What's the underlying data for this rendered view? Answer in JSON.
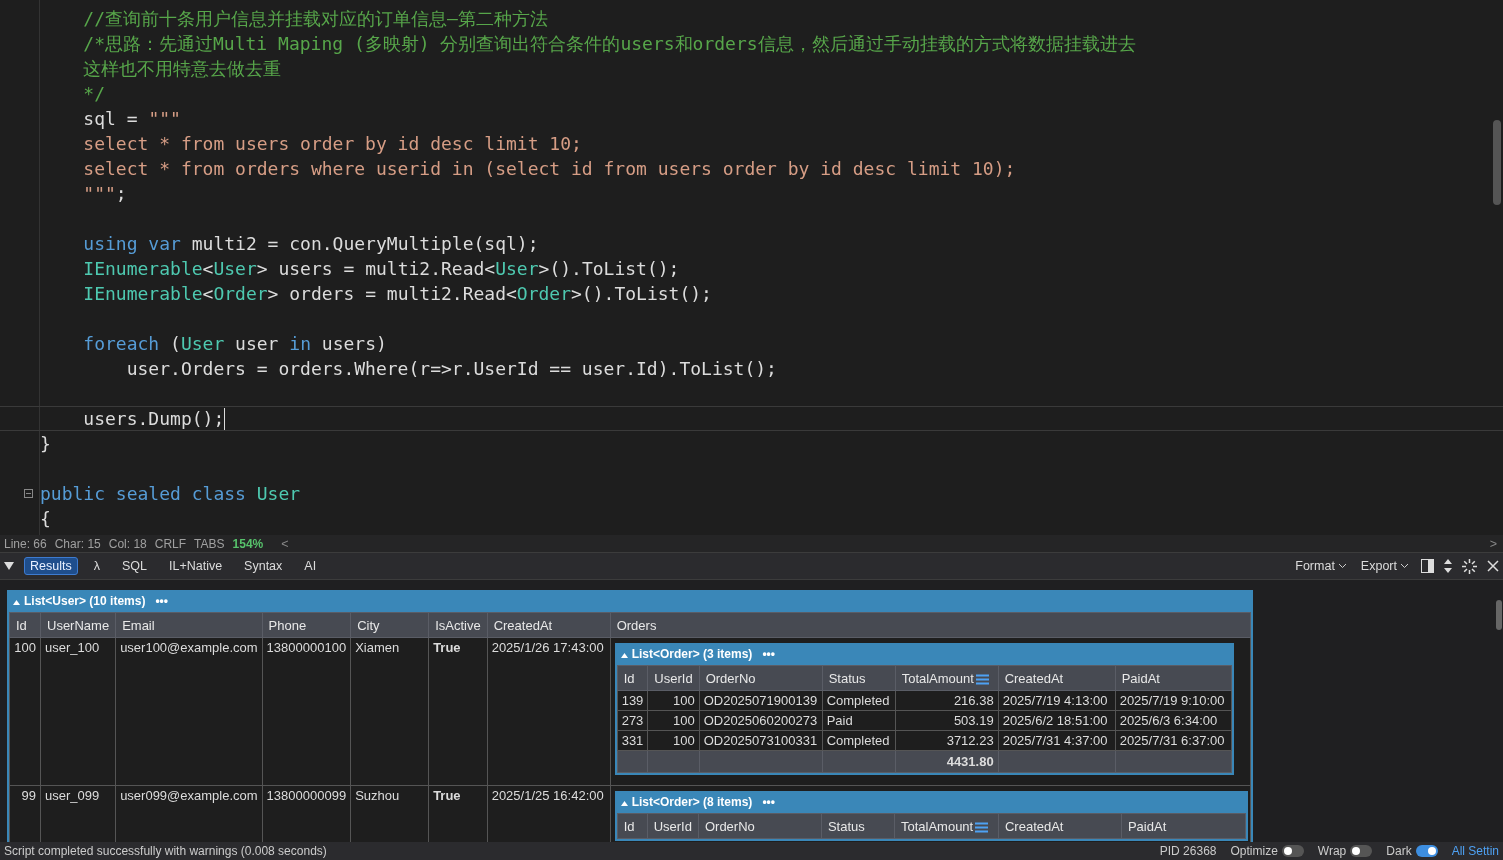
{
  "editor": {
    "lines": [
      {
        "current": false,
        "tokens": [
          {
            "kind": "comment",
            "text": "    //查询前十条用户信息并挂载对应的订单信息—第二种方法"
          }
        ]
      },
      {
        "current": false,
        "tokens": [
          {
            "kind": "comment",
            "text": "    /*思路：先通过Multi Maping (多映射) 分别查询出符合条件的users和orders信息，然后通过手动挂载的方式将数据挂载进去"
          }
        ]
      },
      {
        "current": false,
        "tokens": [
          {
            "kind": "comment",
            "text": "    这样也不用特意去做去重"
          }
        ]
      },
      {
        "current": false,
        "tokens": [
          {
            "kind": "comment",
            "text": "    */"
          }
        ]
      },
      {
        "current": false,
        "tokens": [
          {
            "kind": "plain",
            "text": "    sql = "
          },
          {
            "kind": "string",
            "text": "\"\"\""
          }
        ]
      },
      {
        "current": false,
        "tokens": [
          {
            "kind": "string",
            "text": "    select * from users order by id desc limit 10;"
          }
        ]
      },
      {
        "current": false,
        "tokens": [
          {
            "kind": "string",
            "text": "    select * from orders where userid in (select id from users order by id desc limit 10);"
          }
        ]
      },
      {
        "current": false,
        "tokens": [
          {
            "kind": "string",
            "text": "    \"\"\""
          },
          {
            "kind": "plain",
            "text": ";"
          }
        ]
      },
      {
        "current": false
      },
      {
        "current": false,
        "tokens": [
          {
            "kind": "keyword",
            "text": "    using var"
          },
          {
            "kind": "plain",
            "text": " multi2 = con.QueryMultiple(sql);"
          }
        ]
      },
      {
        "current": false,
        "tokens": [
          {
            "kind": "type",
            "text": "    IEnumerable"
          },
          {
            "kind": "plain",
            "text": "<"
          },
          {
            "kind": "type",
            "text": "User"
          },
          {
            "kind": "plain",
            "text": "> users = multi2.Read<"
          },
          {
            "kind": "type",
            "text": "User"
          },
          {
            "kind": "plain",
            "text": ">().ToList();"
          }
        ]
      },
      {
        "current": false,
        "tokens": [
          {
            "kind": "type",
            "text": "    IEnumerable"
          },
          {
            "kind": "plain",
            "text": "<"
          },
          {
            "kind": "type",
            "text": "Order"
          },
          {
            "kind": "plain",
            "text": "> orders = multi2.Read<"
          },
          {
            "kind": "type",
            "text": "Order"
          },
          {
            "kind": "plain",
            "text": ">().ToList();"
          }
        ]
      },
      {
        "current": false
      },
      {
        "current": false,
        "tokens": [
          {
            "kind": "keyword",
            "text": "    foreach"
          },
          {
            "kind": "plain",
            "text": " ("
          },
          {
            "kind": "type",
            "text": "User"
          },
          {
            "kind": "plain",
            "text": " user "
          },
          {
            "kind": "keyword",
            "text": "in"
          },
          {
            "kind": "plain",
            "text": " users)"
          }
        ]
      },
      {
        "current": false,
        "tokens": [
          {
            "kind": "plain",
            "text": "        user.Orders = orders.Where(r=>r.UserId == user.Id).ToList();"
          }
        ]
      },
      {
        "current": false
      },
      {
        "current": true,
        "tokens": [
          {
            "kind": "plain",
            "text": "    users.Dump();"
          }
        ]
      },
      {
        "current": false,
        "tokens": [
          {
            "kind": "plain",
            "text": "}"
          }
        ]
      },
      {
        "current": false
      },
      {
        "current": false,
        "fold": true,
        "tokens": [
          {
            "kind": "keyword",
            "text": "public sealed class"
          },
          {
            "kind": "type",
            "text": " User"
          }
        ]
      },
      {
        "current": false,
        "tokens": [
          {
            "kind": "plain",
            "text": "{"
          }
        ]
      }
    ]
  },
  "editor_status": {
    "line": "Line: 66",
    "char": "Char: 15",
    "col": "Col: 18",
    "eol": "CRLF",
    "indent": "TABS",
    "zoom": "154%",
    "scroll_left": "<",
    "scroll_right": ">"
  },
  "results_toolbar": {
    "tabs": [
      {
        "label": "Results",
        "selected": true
      },
      {
        "label": "λ",
        "selected": false
      },
      {
        "label": "SQL",
        "selected": false
      },
      {
        "label": "IL+Native",
        "selected": false
      },
      {
        "label": "Syntax",
        "selected": false
      },
      {
        "label": "AI",
        "selected": false
      }
    ],
    "menus": [
      "Format",
      "Export"
    ]
  },
  "users": {
    "title": "List<User> (10 items)",
    "more": "•••",
    "columns": [
      {
        "label": "Id"
      },
      {
        "label": "UserName"
      },
      {
        "label": "Email"
      },
      {
        "label": "Phone"
      },
      {
        "label": "City"
      },
      {
        "label": "IsActive"
      },
      {
        "label": "CreatedAt"
      },
      {
        "label": "Orders"
      }
    ],
    "rows": [
      {
        "cells": [
          "100",
          "user_100",
          "user100@example.com",
          "13800000100",
          "Xiamen",
          "True",
          "2025/1/26 17:43:00"
        ],
        "orders": {
          "title": "List<Order> (3 items)",
          "more": "•••",
          "columns": [
            {
              "label": "Id"
            },
            {
              "label": "UserId"
            },
            {
              "label": "OrderNo"
            },
            {
              "label": "Status"
            },
            {
              "label": "TotalAmount",
              "totals": true
            },
            {
              "label": "CreatedAt"
            },
            {
              "label": "PaidAt"
            }
          ],
          "rows": [
            [
              "139",
              "100",
              "OD2025071900139",
              "Completed",
              "216.38",
              "2025/7/19 4:13:00",
              "2025/7/19 9:10:00"
            ],
            [
              "273",
              "100",
              "OD2025060200273",
              "Paid",
              "503.19",
              "2025/6/2 18:51:00",
              "2025/6/3 6:34:00"
            ],
            [
              "331",
              "100",
              "OD2025073100331",
              "Completed",
              "3712.23",
              "2025/7/31 4:37:00",
              "2025/7/31 6:37:00"
            ]
          ],
          "total": "4431.80"
        }
      },
      {
        "cells": [
          "99",
          "user_099",
          "user099@example.com",
          "13800000099",
          "Suzhou",
          "True",
          "2025/1/25 16:42:00"
        ],
        "orders": {
          "title": "List<Order> (8 items)",
          "more": "•••",
          "columns": [
            {
              "label": "Id"
            },
            {
              "label": "UserId"
            },
            {
              "label": "OrderNo"
            },
            {
              "label": "Status"
            },
            {
              "label": "TotalAmount",
              "totals": true
            },
            {
              "label": "CreatedAt"
            },
            {
              "label": "PaidAt"
            }
          ]
        }
      }
    ]
  },
  "status_bar": {
    "message": "Script completed successfully with warnings (0.008 seconds)",
    "pid": "PID 26368",
    "toggles": [
      {
        "label": "Optimize",
        "on": false
      },
      {
        "label": "Wrap",
        "on": false
      },
      {
        "label": "Dark",
        "on": true
      }
    ],
    "settings_link": "All Settin"
  }
}
